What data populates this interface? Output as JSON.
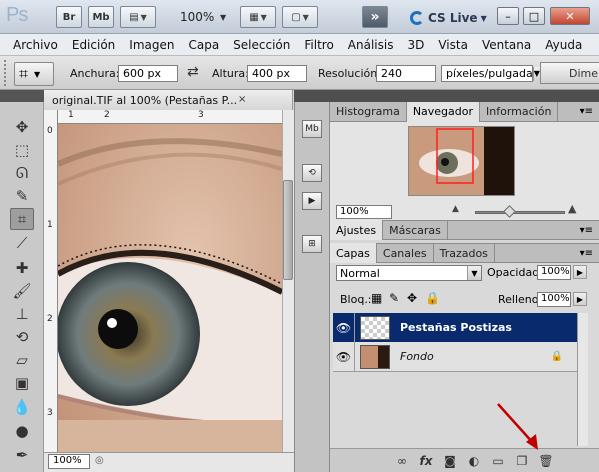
{
  "appbar": {
    "logo": "Ps",
    "buttons": [
      "Br",
      "Mb"
    ],
    "zoom": "100%",
    "cs_live": "CS Live"
  },
  "menu": [
    "Archivo",
    "Edición",
    "Imagen",
    "Capa",
    "Selección",
    "Filtro",
    "Análisis",
    "3D",
    "Vista",
    "Ventana",
    "Ayuda"
  ],
  "options": {
    "width_label": "Anchura:",
    "width_value": "600 px",
    "height_label": "Altura:",
    "height_value": "400 px",
    "resolution_label": "Resolución:",
    "resolution_value": "240",
    "units": "píxeles/pulgada",
    "dims_button": "Dime"
  },
  "document": {
    "title": "original.TIF al 100% (Pestañas P...",
    "close": "×",
    "ruler_h": [
      "1",
      "2",
      "3"
    ],
    "ruler_v": [
      "0",
      "1",
      "2",
      "3"
    ],
    "zoom": "100%"
  },
  "navigator": {
    "tabs": [
      "Histograma",
      "Navegador",
      "Información"
    ],
    "active_tab": 1,
    "zoom": "100%"
  },
  "adjust": {
    "tabs": [
      "Ajustes",
      "Máscaras"
    ]
  },
  "layers": {
    "tabs": [
      "Capas",
      "Canales",
      "Trazados"
    ],
    "blend_mode": "Normal",
    "opacity_label": "Opacidad:",
    "opacity": "100%",
    "lock_label": "Bloq.:",
    "fill_label": "Relleno:",
    "fill": "100%",
    "items": [
      {
        "name": "Pestañas Postizas",
        "selected": true
      },
      {
        "name": "Fondo",
        "selected": false,
        "locked": true
      }
    ]
  },
  "colors": {
    "accent_selected": "#0a2a6e",
    "arrow": "#c00000"
  }
}
